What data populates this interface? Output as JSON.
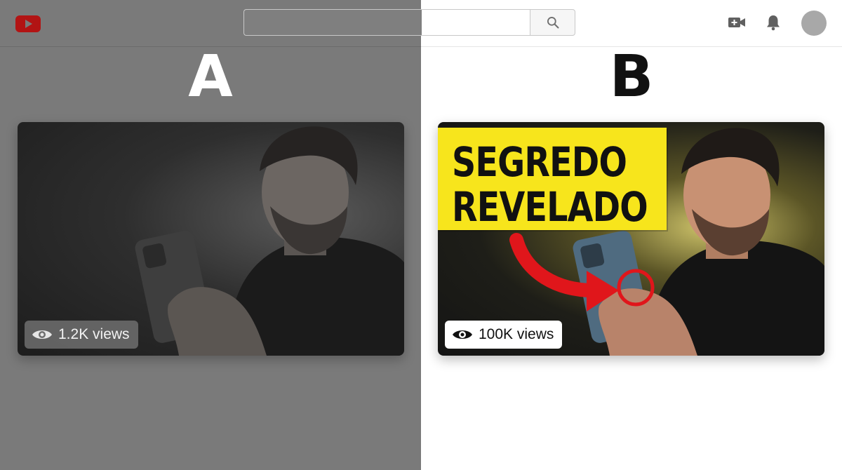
{
  "header": {
    "logo_icon": "youtube-logo-icon",
    "search": {
      "value": "",
      "placeholder": ""
    },
    "search_icon": "search-icon",
    "create_icon": "video-camera-plus-icon",
    "notifications_icon": "bell-icon",
    "avatar_icon": "avatar"
  },
  "variants": [
    {
      "label": "A",
      "views_text": "1.2K views",
      "views_icon": "eye-icon"
    },
    {
      "label": "B",
      "headline_lines": [
        "SEGREDO",
        "REVELADO"
      ],
      "views_text": "100K views",
      "views_icon": "eye-icon",
      "arrow_icon": "red-arrow-icon",
      "highlight_icon": "red-circle-highlight-icon"
    }
  ],
  "colors": {
    "panel_a_background": "#7a7a7a",
    "panel_b_background": "#ffffff",
    "headline_background": "#f7e51c",
    "accent_red": "#e0161b"
  }
}
